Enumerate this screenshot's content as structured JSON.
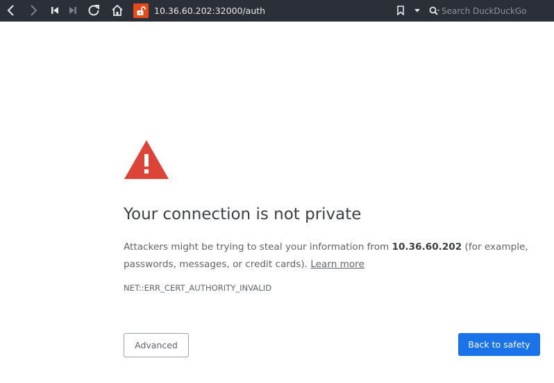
{
  "toolbar": {
    "url": "10.36.60.202:32000/auth",
    "search_placeholder": "Search DuckDuckGo",
    "icons": [
      "back-icon",
      "forward-icon",
      "skip-back-icon",
      "skip-forward-icon",
      "reload-icon",
      "home-icon",
      "insecure-lock-icon",
      "bookmark-icon",
      "dropdown-icon",
      "search-icon"
    ],
    "lock_color": "#e64a19"
  },
  "page": {
    "title": "Your connection is not private",
    "body_prefix": "Attackers might be trying to steal your information from ",
    "host": "10.36.60.202",
    "body_suffix": " (for example, passwords, messages, or credit cards). ",
    "learn_more": "Learn more",
    "error_code": "NET::ERR_CERT_AUTHORITY_INVALID",
    "advanced_label": "Advanced",
    "back_label": "Back to safety",
    "warning_color": "#db4437",
    "primary_button_color": "#1a73e8"
  }
}
